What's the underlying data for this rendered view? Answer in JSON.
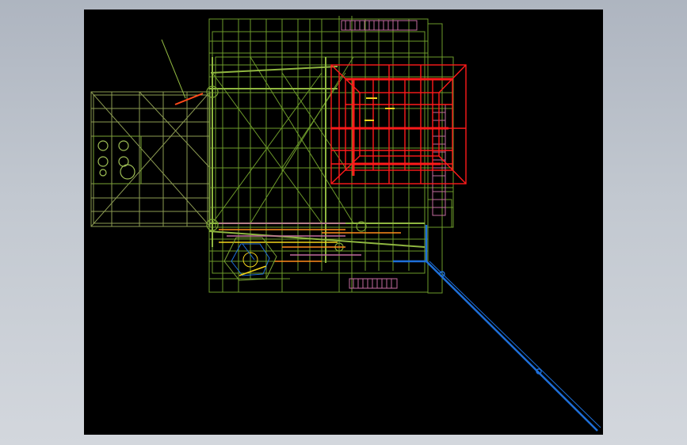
{
  "window": {
    "title": ""
  },
  "viewport": {
    "background": "#000000",
    "view": "top",
    "style": "wireframe"
  },
  "colors": {
    "frame": "#6d9a2a",
    "frame_light": "#8fb640",
    "platform": "#8c9b52",
    "highlight": "#ff1a1a",
    "pipe": "#1e6fd9",
    "stairs": "#c46ca0",
    "warn": "#f2d21b",
    "orange": "#ff8a1a"
  },
  "icons": [
    "cad-model-wireframe"
  ]
}
